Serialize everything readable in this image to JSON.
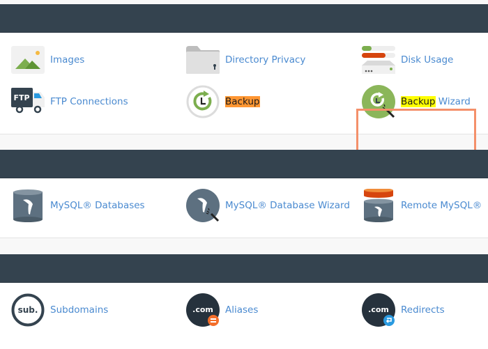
{
  "colors": {
    "header_bg": "#34434f",
    "link": "#4a8ad0",
    "highlight_yellow": "#ffff00",
    "highlight_orange": "#ff9632",
    "selection_border": "#f4906a"
  },
  "sections": [
    {
      "items": [
        {
          "label": "Images",
          "icon": "images-icon"
        },
        {
          "label": "Directory Privacy",
          "icon": "folder-lock-icon"
        },
        {
          "label": "Disk Usage",
          "icon": "disk-usage-icon"
        },
        {
          "label": "FTP Connections",
          "icon": "ftp-truck-icon"
        },
        {
          "label_highlight": "Backup",
          "label_rest": "",
          "icon": "backup-icon"
        },
        {
          "label_highlight": "Backup",
          "label_rest": " Wizard",
          "icon": "backup-wizard-icon",
          "selected": true
        }
      ]
    },
    {
      "items": [
        {
          "label": "MySQL® Databases",
          "icon": "mysql-database-icon"
        },
        {
          "label": "MySQL® Database Wizard",
          "icon": "mysql-wizard-icon"
        },
        {
          "label": "Remote MySQL®",
          "icon": "remote-mysql-icon"
        }
      ]
    },
    {
      "items": [
        {
          "label": "Subdomains",
          "icon": "subdomains-icon",
          "icon_text": "sub."
        },
        {
          "label": "Aliases",
          "icon": "aliases-icon",
          "icon_text": ".com"
        },
        {
          "label": "Redirects",
          "icon": "redirects-icon",
          "icon_text": ".com"
        }
      ]
    }
  ]
}
